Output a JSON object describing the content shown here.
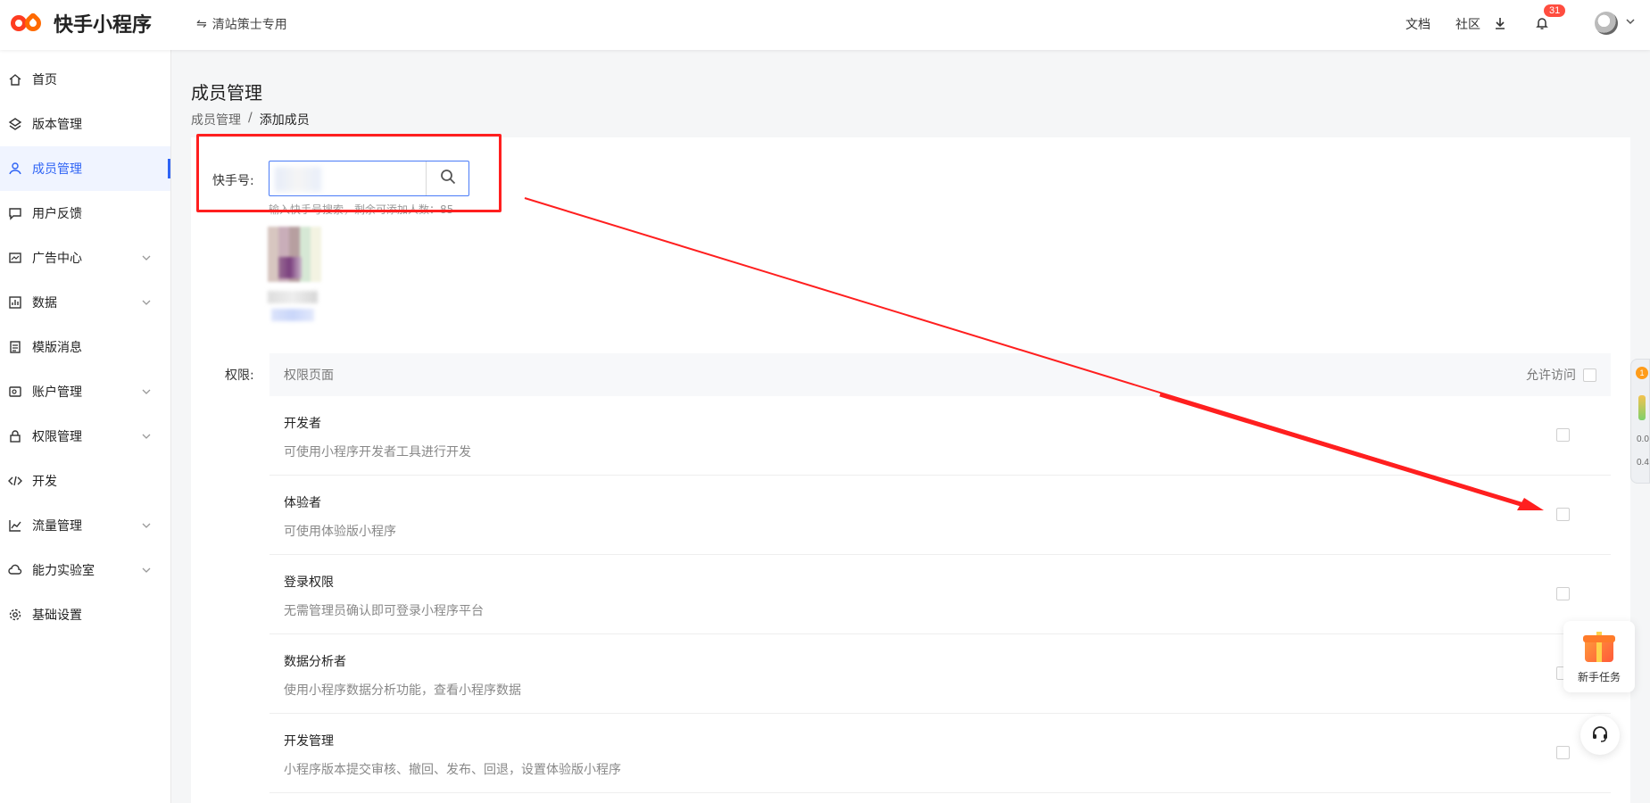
{
  "header": {
    "logo_text": "快手小程序",
    "org_label": "清站策士专用",
    "links": [
      "文档",
      "社区"
    ],
    "notification_count": "31"
  },
  "sidebar": {
    "items": [
      {
        "label": "首页",
        "icon": "home-icon",
        "has_caret": false
      },
      {
        "label": "版本管理",
        "icon": "layers-icon",
        "has_caret": false
      },
      {
        "label": "成员管理",
        "icon": "user-icon",
        "has_caret": false,
        "active": true
      },
      {
        "label": "用户反馈",
        "icon": "message-icon",
        "has_caret": false
      },
      {
        "label": "广告中心",
        "icon": "ad-icon",
        "has_caret": true
      },
      {
        "label": "数据",
        "icon": "chart-icon",
        "has_caret": true
      },
      {
        "label": "模版消息",
        "icon": "template-icon",
        "has_caret": false
      },
      {
        "label": "账户管理",
        "icon": "account-icon",
        "has_caret": true
      },
      {
        "label": "权限管理",
        "icon": "lock-icon",
        "has_caret": true
      },
      {
        "label": "开发",
        "icon": "code-icon",
        "has_caret": false
      },
      {
        "label": "流量管理",
        "icon": "trend-icon",
        "has_caret": true
      },
      {
        "label": "能力实验室",
        "icon": "cloud-icon",
        "has_caret": true
      },
      {
        "label": "基础设置",
        "icon": "gear-icon",
        "has_caret": false
      }
    ]
  },
  "page": {
    "title": "成员管理",
    "breadcrumb": [
      "成员管理",
      "/",
      "添加成员"
    ]
  },
  "search": {
    "label": "快手号:",
    "value": "",
    "hint": "输入快手号搜索，剩余可添加人数：85"
  },
  "permissions": {
    "label": "权限:",
    "header_col": "权限页面",
    "header_allow": "允许访问",
    "rows": [
      {
        "name": "开发者",
        "desc": "可使用小程序开发者工具进行开发"
      },
      {
        "name": "体验者",
        "desc": "可使用体验版小程序"
      },
      {
        "name": "登录权限",
        "desc": "无需管理员确认即可登录小程序平台"
      },
      {
        "name": "数据分析者",
        "desc": "使用小程序数据分析功能，查看小程序数据"
      },
      {
        "name": "开发管理",
        "desc": "小程序版本提交审核、撤回、发布、回退，设置体验版小程序"
      }
    ]
  },
  "widgets": {
    "side_badge": "1",
    "side_value_1": "0.0",
    "side_value_2": "0.4",
    "newbie_label": "新手任务"
  },
  "colors": {
    "accent": "#2f64f5",
    "annotation_red": "#ff1f1f",
    "brand": "#fe3c21"
  }
}
